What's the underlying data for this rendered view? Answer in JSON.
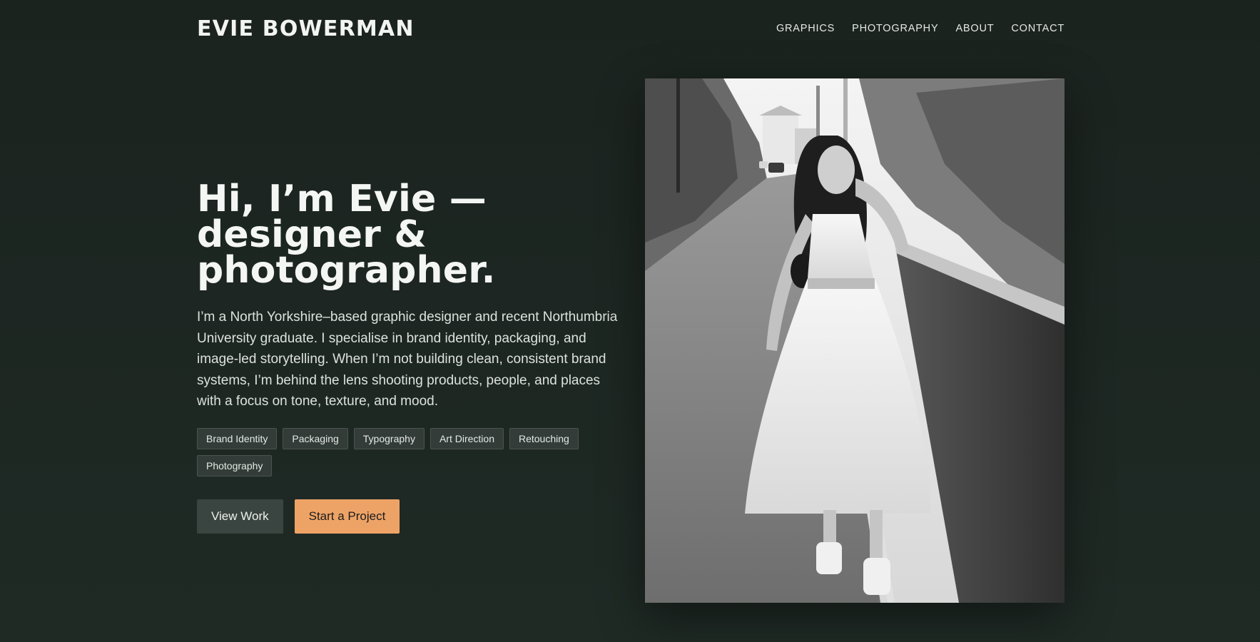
{
  "header": {
    "logo": "EVIE BOWERMAN",
    "nav": [
      "GRAPHICS",
      "PHOTOGRAPHY",
      "ABOUT",
      "CONTACT"
    ]
  },
  "hero": {
    "heading_line1": "Hi, I’m Evie — designer &",
    "heading_line2": "photographer.",
    "bio": "I’m a North Yorkshire–based graphic designer and recent Northumbria University graduate. I specialise in brand identity, packaging, and image-led storytelling. When I’m not building clean, consistent brand systems, I’m behind the lens shooting products, people, and places with a focus on tone, texture, and mood.",
    "tags": [
      "Brand Identity",
      "Packaging",
      "Typography",
      "Art Direction",
      "Retouching",
      "Photography"
    ],
    "buttons": {
      "view_work": "View Work",
      "start_project": "Start a Project"
    }
  },
  "colors": {
    "background": "#1c2621",
    "accent": "#eea366",
    "tag_bg": "#333c38"
  },
  "image": {
    "subject": "portrait-photo"
  }
}
